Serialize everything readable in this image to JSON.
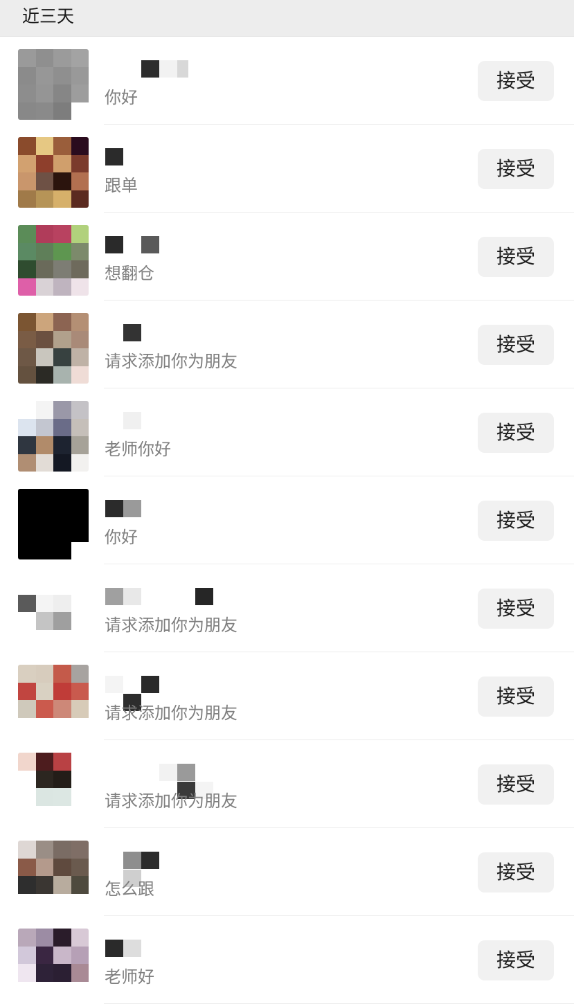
{
  "section": {
    "title": "近三天"
  },
  "rows": [
    {
      "message": "你好",
      "accept_label": "接受",
      "avatar": [
        "#9a9a9a",
        "#8f8f8f",
        "#9b9b9b",
        "#a3a3a3",
        "#8b8b8b",
        "#979797",
        "#8f8f8f",
        "#999999",
        "#8d8d8d",
        "#959595",
        "#868686",
        "#9d9d9d",
        "#888888",
        "#8a8a8a",
        "#7d7d7d",
        "#ffffff"
      ],
      "name_blocks": [
        "#2d2d2d",
        "#f2f2f2",
        "#d8d8d8"
      ]
    },
    {
      "message": "跟单",
      "accept_label": "接受",
      "avatar": [
        "#8a4b2c",
        "#e6c883",
        "#9a5e3b",
        "#2a0c1e",
        "#d2a170",
        "#8e3f2c",
        "#d09f6c",
        "#7b3b2c",
        "#c9966c",
        "#6e5145",
        "#2b140d",
        "#b27050",
        "#a07a49",
        "#b69457",
        "#d6b06a",
        "#5b2a20"
      ],
      "name_blocks": [
        "#2b2b2b"
      ]
    },
    {
      "message": "想翻仓",
      "accept_label": "接受",
      "avatar": [
        "#5b8c58",
        "#b03c5a",
        "#b84260",
        "#b1d17c",
        "#5b8a63",
        "#5f7f59",
        "#5e9650",
        "#7c8a6b",
        "#2f4c2f",
        "#6a6a5a",
        "#7d7d74",
        "#6e6a5c",
        "#de5fa8",
        "#d9d2d6",
        "#bfb4bf",
        "#efe3e9"
      ],
      "name_blocks": [
        "#2a2a2a",
        "#5a5a5a"
      ]
    },
    {
      "message": "请求添加你为朋友",
      "accept_label": "接受",
      "avatar": [
        "#7b5532",
        "#cca57c",
        "#8c6452",
        "#b48f74",
        "#7a5c45",
        "#6b5040",
        "#b1a18c",
        "#a98a78",
        "#6e5846",
        "#c9c6be",
        "#374140",
        "#bfb2a6",
        "#64513f",
        "#2b2a25",
        "#a8b3ae",
        "#efdcd6"
      ],
      "name_blocks": [
        "#333333"
      ]
    },
    {
      "message": "老师你好",
      "accept_label": "接受",
      "avatar": [
        "#ffffff",
        "#f4f4f4",
        "#9a98a8",
        "#c4c2c6",
        "#dce4ef",
        "#c3c6d0",
        "#6a6c88",
        "#c5bfb9",
        "#2f3640",
        "#b18b6a",
        "#1d2330",
        "#a6a298",
        "#b08e73",
        "#e2dcd6",
        "#141823",
        "#f2f1ef"
      ],
      "name_blocks": [
        "#f0f0f0"
      ]
    },
    {
      "message": "你好",
      "accept_label": "接受",
      "avatar": [
        "#000000",
        "#000000",
        "#000000",
        "#000000",
        "#000000",
        "#000000",
        "#000000",
        "#000000",
        "#000000",
        "#000000",
        "#000000",
        "#000000",
        "#000000",
        "#000000",
        "#000000",
        "#ffffff"
      ],
      "name_blocks": [
        "#2b2b2b",
        "#9a9a9a"
      ]
    },
    {
      "message": "请求添加你为朋友",
      "accept_label": "接受",
      "avatar": [
        "#ffffff",
        "#ffffff",
        "#ffffff",
        "#ffffff",
        "#5a5a5a",
        "#f4f4f4",
        "#eeeeee",
        "#ffffff",
        "#ffffff",
        "#c4c4c4",
        "#9f9f9f",
        "#ffffff",
        "#ffffff",
        "#ffffff",
        "#ffffff",
        "#ffffff"
      ],
      "name_blocks": [
        "#a0a0a0",
        "#e8e8e8",
        "#262626"
      ]
    },
    {
      "message": "请求添加你为朋友",
      "accept_label": "接受",
      "avatar": [
        "#d9cfc0",
        "#d7ccbd",
        "#c45a4a",
        "#a7a3a0",
        "#c14540",
        "#d9d1c2",
        "#c03c38",
        "#c95a4e",
        "#cfc9bb",
        "#cb5a4d",
        "#cd8878",
        "#d7cbb8",
        "#ffffff",
        "#ffffff",
        "#ffffff",
        "#ffffff"
      ],
      "name_blocks": [
        "#f4f4f4",
        "#2a2a2a",
        "#2d2d2d"
      ]
    },
    {
      "message": "请求添加你为朋友",
      "accept_label": "接受",
      "avatar": [
        "#f1d6cc",
        "#4d1c1e",
        "#b94144",
        "#ffffff",
        "#ffffff",
        "#2c2620",
        "#231d18",
        "#ffffff",
        "#ffffff",
        "#dbe6e2",
        "#dce7e3",
        "#ffffff",
        "#ffffff",
        "#ffffff",
        "#ffffff",
        "#ffffff"
      ],
      "name_blocks": [
        "#f2f2f2",
        "#9a9a9a",
        "#3a3a3a",
        "#f4f4f4"
      ]
    },
    {
      "message": "怎么跟",
      "accept_label": "接受",
      "avatar": [
        "#ded7d4",
        "#9a8e86",
        "#7a6c64",
        "#7f6e66",
        "#8a5a48",
        "#b49a8c",
        "#5f4a3e",
        "#6a5a4e",
        "#2e2e2e",
        "#3a3632",
        "#b8ac9e",
        "#4e4a3e",
        "#ffffff",
        "#ffffff",
        "#ffffff",
        "#ffffff"
      ],
      "name_blocks": [
        "#8e8e8e",
        "#2c2c2c",
        "#cfcfcf"
      ]
    },
    {
      "message": "老师好",
      "accept_label": "接受",
      "avatar": [
        "#b9a8b9",
        "#9c8ca4",
        "#2a1c2a",
        "#d8c9d6",
        "#d2c8da",
        "#3a2642",
        "#c9b7c9",
        "#b6a0b6",
        "#efe6f0",
        "#2e2238",
        "#2b1f33",
        "#a98a95",
        "#ffffff",
        "#ffffff",
        "#ffffff",
        "#ffffff"
      ],
      "name_blocks": [
        "#2a2a2a",
        "#dddddd"
      ]
    }
  ]
}
